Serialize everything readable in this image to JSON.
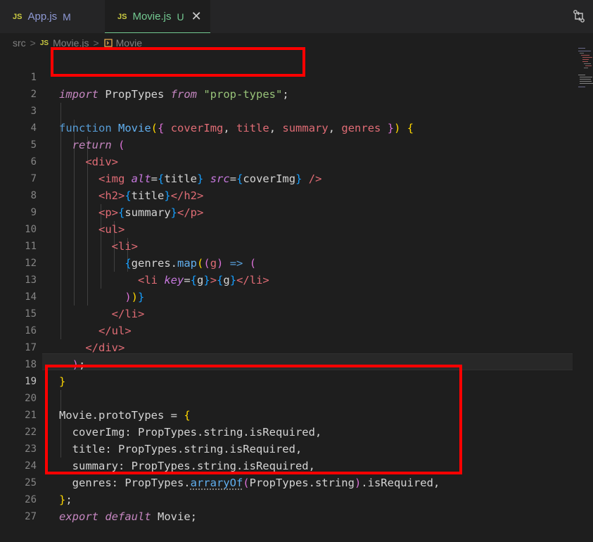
{
  "tabs": [
    {
      "js": "JS",
      "name": "App.js",
      "badge": "M"
    },
    {
      "js": "JS",
      "name": "Movie.js",
      "badge": "U",
      "close": "✕"
    }
  ],
  "breadcrumb": {
    "folder": "src",
    "sep": ">",
    "js": "JS",
    "file": "Movie.js",
    "symbol": "Movie"
  },
  "lines": [
    {
      "n": "1",
      "t": "import PropTypes from \"prop-types\";"
    },
    {
      "n": "2",
      "t": ""
    },
    {
      "n": "3",
      "t": "function Movie({ coverImg, title, summary, genres }) {"
    },
    {
      "n": "4",
      "t": "  return ("
    },
    {
      "n": "5",
      "t": "    <div>"
    },
    {
      "n": "6",
      "t": "      <img alt={title} src={coverImg} />"
    },
    {
      "n": "7",
      "t": "      <h2>{title}</h2>"
    },
    {
      "n": "8",
      "t": "      <p>{summary}</p>"
    },
    {
      "n": "9",
      "t": "      <ul>"
    },
    {
      "n": "10",
      "t": "        <li>"
    },
    {
      "n": "11",
      "t": "          {genres.map((g) => ("
    },
    {
      "n": "12",
      "t": "            <li key={g}>{g}</li>"
    },
    {
      "n": "13",
      "t": "          ))}"
    },
    {
      "n": "14",
      "t": "        </li>"
    },
    {
      "n": "15",
      "t": "      </ul>"
    },
    {
      "n": "16",
      "t": "    </div>"
    },
    {
      "n": "17",
      "t": "  );"
    },
    {
      "n": "18",
      "t": "}"
    },
    {
      "n": "19",
      "t": ""
    },
    {
      "n": "20",
      "t": "Movie.protoTypes = {"
    },
    {
      "n": "21",
      "t": "  coverImg: PropTypes.string.isRequired,"
    },
    {
      "n": "22",
      "t": "  title: PropTypes.string.isRequired,"
    },
    {
      "n": "23",
      "t": "  summary: PropTypes.string.isRequired,"
    },
    {
      "n": "24",
      "t": "  genres: PropTypes.arraryOf(PropTypes.string).isRequired,"
    },
    {
      "n": "25",
      "t": "};"
    },
    {
      "n": "26",
      "t": "export default Movie;"
    },
    {
      "n": "27",
      "t": ""
    }
  ],
  "current_line": "19",
  "colors": {
    "highlight_box": "#ff0000",
    "accent": "#73c991",
    "js_icon": "#cbcb41"
  }
}
